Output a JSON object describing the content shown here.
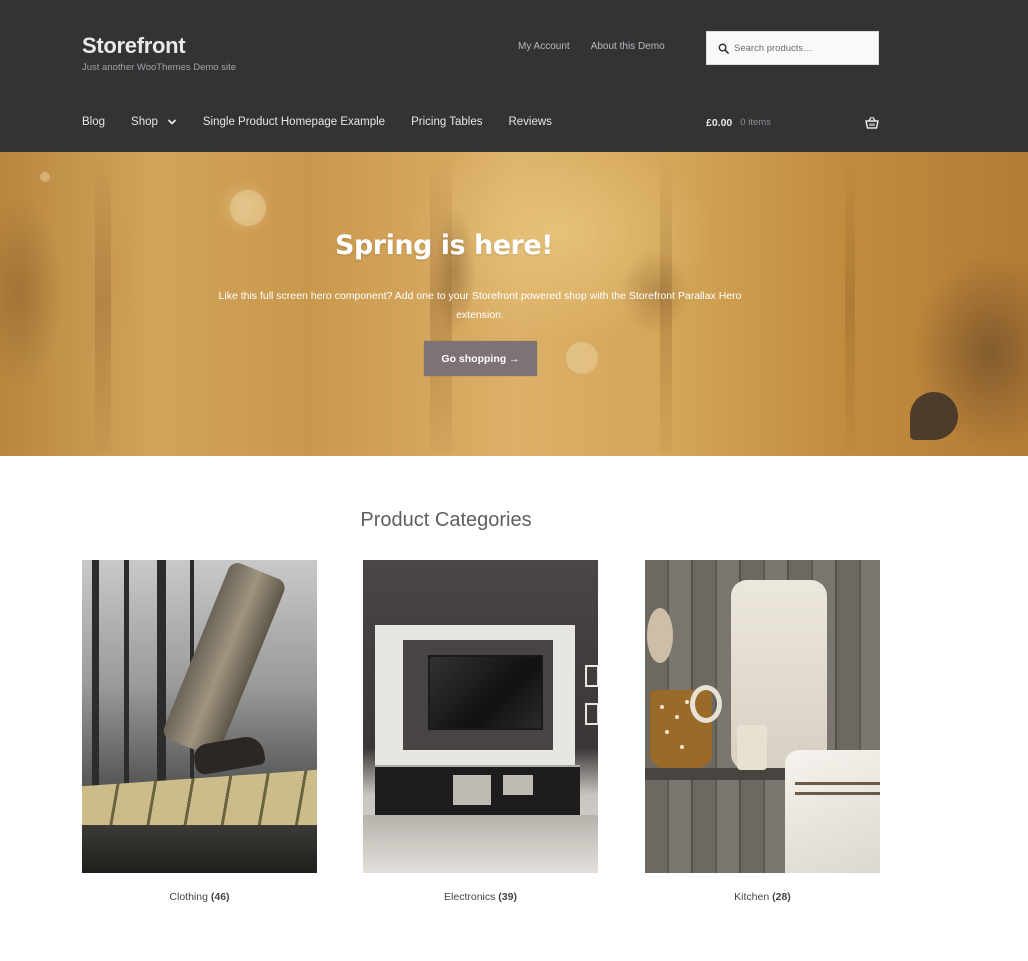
{
  "header": {
    "site_title": "Storefront",
    "site_tagline": "Just another WooThemes Demo site",
    "secondary_nav": [
      "My Account",
      "About this Demo"
    ],
    "search": {
      "placeholder": "Search products…"
    },
    "main_nav": [
      {
        "label": "Blog",
        "has_dropdown": false
      },
      {
        "label": "Shop",
        "has_dropdown": true
      },
      {
        "label": "Single Product Homepage Example",
        "has_dropdown": false
      },
      {
        "label": "Pricing Tables",
        "has_dropdown": false
      },
      {
        "label": "Reviews",
        "has_dropdown": false
      }
    ],
    "cart": {
      "total": "£0.00",
      "count": "0 items",
      "icon": "basket-icon"
    }
  },
  "hero": {
    "title": "Spring is here!",
    "text": "Like this full screen hero component? Add one to your Storefront powered shop with the Storefront Parallax Hero extension.",
    "button_label": "Go shopping →"
  },
  "categories": {
    "title": "Product Categories",
    "items": [
      {
        "name": "Clothing",
        "count": "(46)"
      },
      {
        "name": "Electronics",
        "count": "(39)"
      },
      {
        "name": "Kitchen",
        "count": "(28)"
      }
    ]
  },
  "colors": {
    "header_bg": "#333336",
    "hero_button_bg": "#7d7276",
    "hero_tint": "#c9984d"
  }
}
